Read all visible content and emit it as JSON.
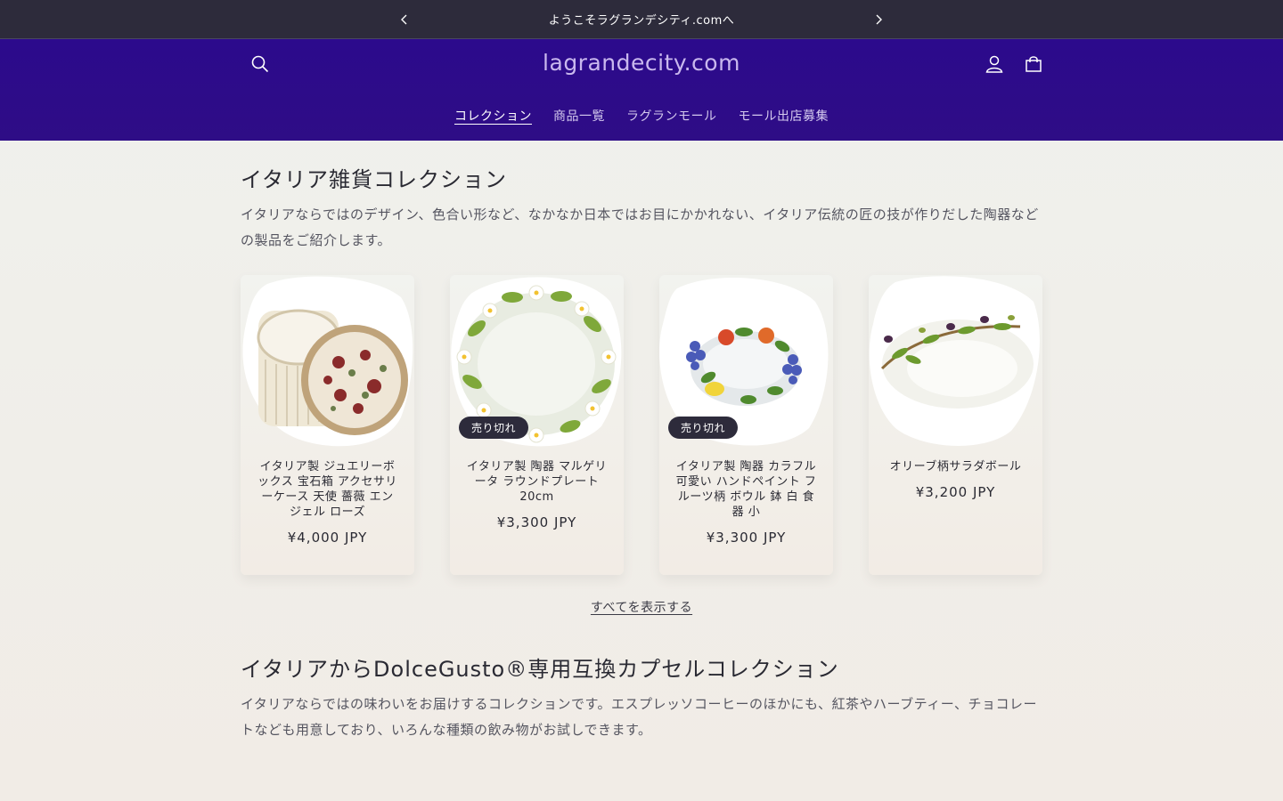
{
  "announcement": {
    "text": "ようこそラグランデシティ.comへ"
  },
  "header": {
    "logo": "lagrandecity.com",
    "nav": [
      {
        "label": "コレクション"
      },
      {
        "label": "商品一覧"
      },
      {
        "label": "ラグランモール"
      },
      {
        "label": "モール出店募集"
      }
    ]
  },
  "icons": {
    "search": "search-icon",
    "account": "account-icon",
    "cart": "cart-icon",
    "prev": "chevron-left-icon",
    "next": "chevron-right-icon"
  },
  "colors": {
    "announcement_bg": "#2d2b3b",
    "header_bg": "#2c0a8c",
    "logo": "#c9b8ee",
    "badge_bg": "#2d2b3b"
  },
  "section1": {
    "title": "イタリア雑貨コレクション",
    "description": "イタリアならではのデザイン、色合い形など、なかなか日本ではお目にかかれない、イタリア伝統の匠の技が作りだした陶器などの製品をご紹介します。",
    "products": [
      {
        "name": "イタリア製 ジュエリーボックス 宝石箱 アクセサリーケース 天使 薔薇 エンジェル ローズ",
        "price": "¥4,000 JPY",
        "badge": ""
      },
      {
        "name": "イタリア製 陶器 マルゲリータ ラウンドプレート 20cm",
        "price": "¥3,300 JPY",
        "badge": "売り切れ"
      },
      {
        "name": "イタリア製 陶器 カラフル 可愛い ハンドペイント フルーツ柄 ボウル 鉢 白 食器 小",
        "price": "¥3,300 JPY",
        "badge": "売り切れ"
      },
      {
        "name": "オリーブ柄サラダボール",
        "price": "¥3,200 JPY",
        "badge": ""
      }
    ],
    "view_all": "すべてを表示する"
  },
  "section2": {
    "title": "イタリアからDolceGusto®専用互換カプセルコレクション",
    "description": "イタリアならではの味わいをお届けするコレクションです。エスプレッソコーヒーのほかにも、紅茶やハーブティー、チョコレートなども用意しており、いろんな種類の飲み物がお試しできます。"
  }
}
